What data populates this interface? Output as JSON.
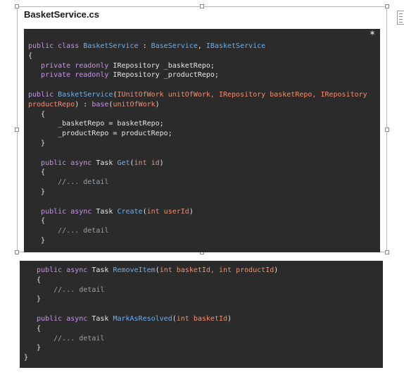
{
  "document": {
    "file_title": "BasketService.cs"
  },
  "code_block_top": {
    "lines": [
      {
        "segments": [
          {
            "t": "public class ",
            "c": "kw"
          },
          {
            "t": "BasketService",
            "c": "ty"
          },
          {
            "t": " : ",
            "c": "pl"
          },
          {
            "t": "BaseService",
            "c": "ty"
          },
          {
            "t": ", ",
            "c": "pl"
          },
          {
            "t": "IBasketService",
            "c": "ty"
          }
        ]
      },
      {
        "segments": [
          {
            "t": "{",
            "c": "pl"
          }
        ]
      },
      {
        "segments": [
          {
            "t": "   private readonly ",
            "c": "kw"
          },
          {
            "t": "IRepository _basketRepo;",
            "c": "pl"
          }
        ]
      },
      {
        "segments": [
          {
            "t": "   private readonly ",
            "c": "kw"
          },
          {
            "t": "IRepository _productRepo;",
            "c": "pl"
          }
        ]
      },
      {
        "segments": [
          {
            "t": "",
            "c": "pl"
          }
        ]
      },
      {
        "segments": [
          {
            "t": "public ",
            "c": "kw"
          },
          {
            "t": "BasketService",
            "c": "fn"
          },
          {
            "t": "(",
            "c": "pl"
          },
          {
            "t": "IUnitOfWork unitOfWork, IRepository basketRepo, IRepository",
            "c": "pa"
          }
        ]
      },
      {
        "segments": [
          {
            "t": "productRepo",
            "c": "pa"
          },
          {
            "t": ") : ",
            "c": "pl"
          },
          {
            "t": "base",
            "c": "kw"
          },
          {
            "t": "(",
            "c": "pl"
          },
          {
            "t": "unitOfWork",
            "c": "pa"
          },
          {
            "t": ")",
            "c": "pl"
          }
        ]
      },
      {
        "segments": [
          {
            "t": "   {",
            "c": "pl"
          }
        ]
      },
      {
        "segments": [
          {
            "t": "       _basketRepo = basketRepo;",
            "c": "pl"
          }
        ]
      },
      {
        "segments": [
          {
            "t": "       _productRepo = productRepo;",
            "c": "pl"
          }
        ]
      },
      {
        "segments": [
          {
            "t": "   }",
            "c": "pl"
          }
        ]
      },
      {
        "segments": [
          {
            "t": "",
            "c": "pl"
          }
        ]
      },
      {
        "segments": [
          {
            "t": "   public async ",
            "c": "kw"
          },
          {
            "t": "Task ",
            "c": "pl"
          },
          {
            "t": "Get",
            "c": "fn"
          },
          {
            "t": "(",
            "c": "pl"
          },
          {
            "t": "int id",
            "c": "pa"
          },
          {
            "t": ")",
            "c": "pl"
          }
        ]
      },
      {
        "segments": [
          {
            "t": "   {",
            "c": "pl"
          }
        ]
      },
      {
        "segments": [
          {
            "t": "       //... detail",
            "c": "cm"
          }
        ]
      },
      {
        "segments": [
          {
            "t": "   }",
            "c": "pl"
          }
        ]
      },
      {
        "segments": [
          {
            "t": "",
            "c": "pl"
          }
        ]
      },
      {
        "segments": [
          {
            "t": "   public async ",
            "c": "kw"
          },
          {
            "t": "Task ",
            "c": "pl"
          },
          {
            "t": "Create",
            "c": "fn"
          },
          {
            "t": "(",
            "c": "pl"
          },
          {
            "t": "int userId",
            "c": "pa"
          },
          {
            "t": ")",
            "c": "pl"
          }
        ]
      },
      {
        "segments": [
          {
            "t": "   {",
            "c": "pl"
          }
        ]
      },
      {
        "segments": [
          {
            "t": "       //... detail",
            "c": "cm"
          }
        ]
      },
      {
        "segments": [
          {
            "t": "   }",
            "c": "pl"
          }
        ]
      }
    ]
  },
  "code_block_bottom": {
    "lines": [
      {
        "segments": [
          {
            "t": "   public async ",
            "c": "kw"
          },
          {
            "t": "Task ",
            "c": "pl"
          },
          {
            "t": "RemoveItem",
            "c": "fn"
          },
          {
            "t": "(",
            "c": "pl"
          },
          {
            "t": "int basketId, int productId",
            "c": "pa"
          },
          {
            "t": ")",
            "c": "pl"
          }
        ]
      },
      {
        "segments": [
          {
            "t": "   {",
            "c": "pl"
          }
        ]
      },
      {
        "segments": [
          {
            "t": "       //... detail",
            "c": "cm"
          }
        ]
      },
      {
        "segments": [
          {
            "t": "   }",
            "c": "pl"
          }
        ]
      },
      {
        "segments": [
          {
            "t": "",
            "c": "pl"
          }
        ]
      },
      {
        "segments": [
          {
            "t": "   public async ",
            "c": "kw"
          },
          {
            "t": "Task ",
            "c": "pl"
          },
          {
            "t": "MarkAsResolved",
            "c": "fn"
          },
          {
            "t": "(",
            "c": "pl"
          },
          {
            "t": "int basketId",
            "c": "pa"
          },
          {
            "t": ")",
            "c": "pl"
          }
        ]
      },
      {
        "segments": [
          {
            "t": "   {",
            "c": "pl"
          }
        ]
      },
      {
        "segments": [
          {
            "t": "       //... detail",
            "c": "cm"
          }
        ]
      },
      {
        "segments": [
          {
            "t": "   }",
            "c": "pl"
          }
        ]
      },
      {
        "segments": [
          {
            "t": "}",
            "c": "pl"
          }
        ]
      }
    ]
  },
  "icons": {
    "scatter_icon": "✶",
    "side_tab_icon": "list-icon"
  }
}
